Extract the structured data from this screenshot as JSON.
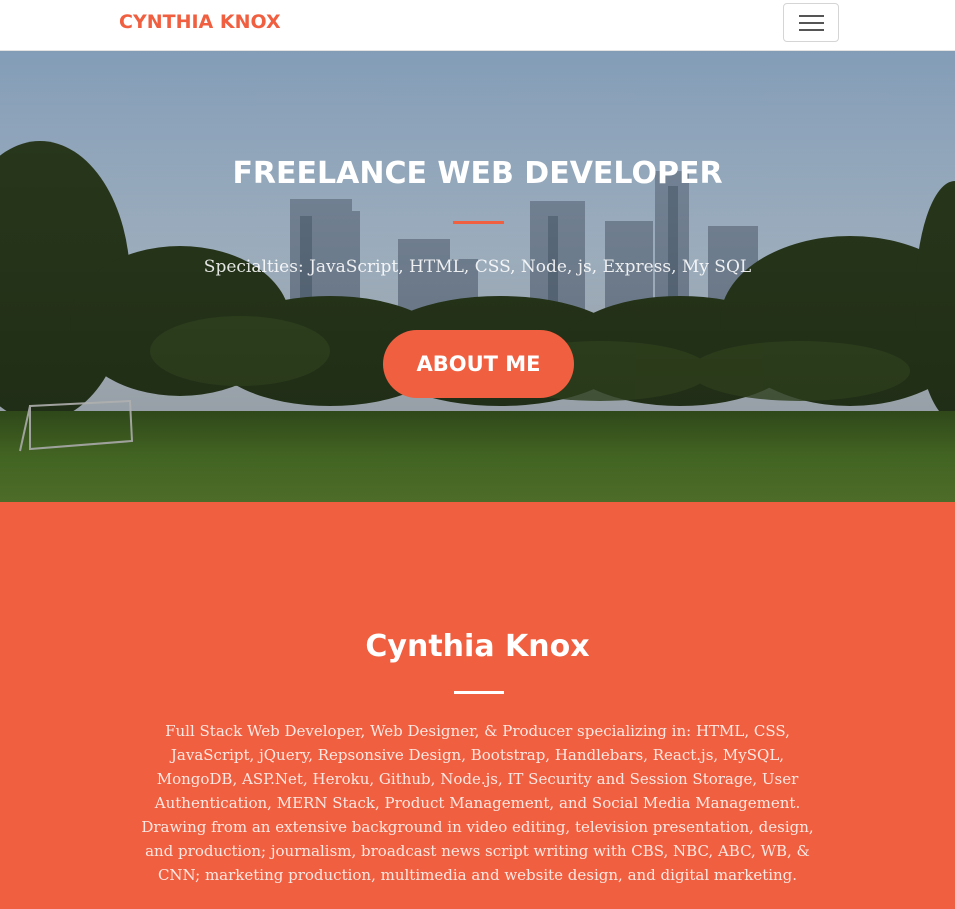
{
  "navbar": {
    "brand": "CYNTHIA KNOX",
    "toggler_label": "Toggle navigation",
    "brand_color": "#f05f40"
  },
  "hero": {
    "title": "FREELANCE WEB DEVELOPER",
    "subtitle": "Specialties: JavaScript, HTML, CSS, Node, js, Express, My SQL",
    "button_label": "ABOUT ME",
    "accent_color": "#f05f40"
  },
  "about": {
    "title": "Cynthia Knox",
    "text": "Full Stack Web Developer, Web Designer, & Producer specializing in: HTML, CSS, JavaScript, jQuery, Repsonsive Design, Bootstrap, Handlebars, React.js, MySQL, MongoDB, ASP.Net, Heroku, Github, Node.js, IT Security and Session Storage, User Authentication, MERN Stack, Product Management, and Social Media Management. Drawing from an extensive background in video editing, television presentation, design, and production; journalism, broadcast news script writing with CBS, NBC, ABC, WB, & CNN; marketing production, multimedia and website design, and digital marketing.",
    "background_color": "#f05f40"
  }
}
